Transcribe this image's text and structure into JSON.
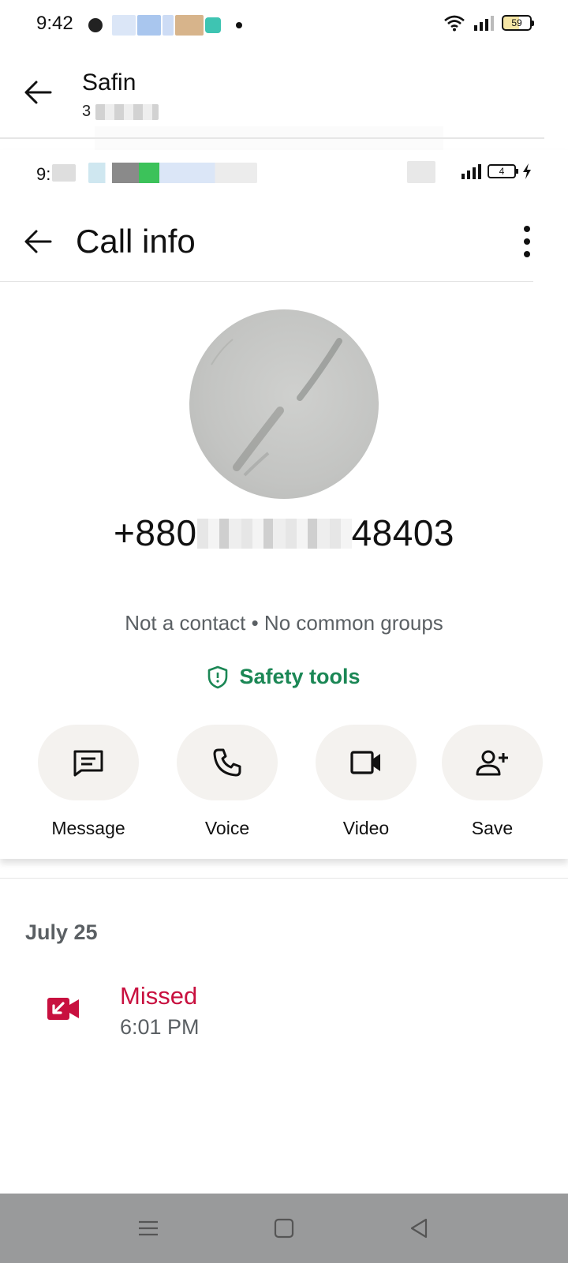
{
  "status_bar": {
    "time": "9:42",
    "battery": "59"
  },
  "chat": {
    "contact_name": "Safin",
    "subtitle": "3"
  },
  "inner_status": {
    "time": "9:",
    "battery": "4"
  },
  "call_info": {
    "title": "Call info",
    "phone_prefix": "+880",
    "phone_suffix": "48403",
    "meta": "Not a contact • No common groups",
    "safety_label": "Safety tools",
    "actions": [
      {
        "label": "Message",
        "icon": "message-icon"
      },
      {
        "label": "Voice",
        "icon": "phone-icon"
      },
      {
        "label": "Video",
        "icon": "video-icon"
      },
      {
        "label": "Save",
        "icon": "add-person-icon"
      }
    ]
  },
  "call_log": {
    "date": "July 25",
    "entries": [
      {
        "status": "Missed",
        "time": "6:01 PM",
        "icon": "missed-video-call-icon"
      }
    ]
  },
  "colors": {
    "accent_green": "#1b8755",
    "missed_red": "#c8103f",
    "pill_bg": "#f4f2ef",
    "navbar_bg": "#999a9b"
  },
  "nav": {
    "buttons": [
      "menu-icon",
      "home-icon",
      "back-icon"
    ]
  }
}
